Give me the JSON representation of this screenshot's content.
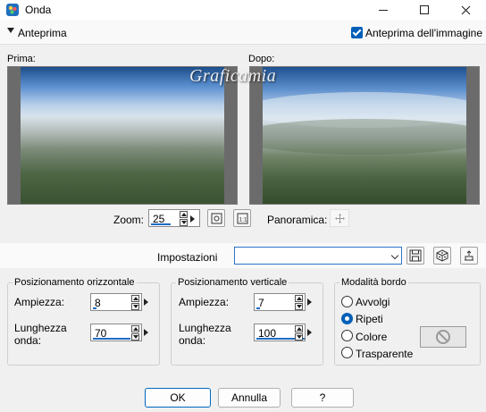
{
  "window": {
    "title": "Onda"
  },
  "preview": {
    "section_label": "Anteprima",
    "image_preview_label": "Anteprima dell'immagine",
    "image_preview_checked": true,
    "before_label": "Prima:",
    "after_label": "Dopo:",
    "watermark": "Graficamia"
  },
  "zoom": {
    "label": "Zoom:",
    "value": "25",
    "pan_label": "Panoramica:"
  },
  "settings": {
    "label": "Impostazioni",
    "value": ""
  },
  "horizontal": {
    "title": "Posizionamento orizzontale",
    "amplitude_label": "Ampiezza:",
    "amplitude": "8",
    "wavelength_label_1": "Lunghezza",
    "wavelength_label_2": "onda:",
    "wavelength": "70"
  },
  "vertical": {
    "title": "Posizionamento verticale",
    "amplitude_label": "Ampiezza:",
    "amplitude": "7",
    "wavelength_label_1": "Lunghezza",
    "wavelength_label_2": "onda:",
    "wavelength": "100"
  },
  "edge_mode": {
    "title": "Modalità bordo",
    "options": [
      "Avvolgi",
      "Ripeti",
      "Colore",
      "Trasparente"
    ],
    "selected": "Ripeti"
  },
  "buttons": {
    "ok": "OK",
    "cancel": "Annulla",
    "help": "?"
  },
  "colors": {
    "accent": "#005fb8"
  }
}
